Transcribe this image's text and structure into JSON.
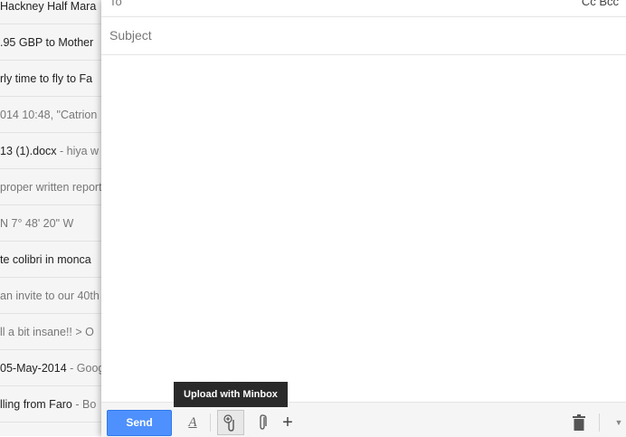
{
  "inbox": {
    "rows": [
      {
        "text": " Hackney Half Mara",
        "snippet": "",
        "read": false
      },
      {
        "text": ".95 GBP to Mother",
        "snippet": "",
        "read": false
      },
      {
        "text": "rly time to fly to Fa",
        "snippet": "",
        "read": false
      },
      {
        "text": "014 10:48, \"Catrion",
        "snippet": "",
        "read": true
      },
      {
        "text": "13 (1).docx",
        "snippet": " - hiya w",
        "read": false
      },
      {
        "text": "proper written report",
        "snippet": "",
        "read": true
      },
      {
        "text": "N 7° 48' 20\" W",
        "snippet": "",
        "read": true
      },
      {
        "text": "te colibri in monca",
        "snippet": "",
        "read": false
      },
      {
        "text": "an invite to our 40th",
        "snippet": "",
        "read": true
      },
      {
        "text": "ll a bit insane!! > O",
        "snippet": "",
        "read": true
      },
      {
        "text": "05-May-2014",
        "snippet": " - Goog",
        "read": false
      },
      {
        "text": "lling from Faro",
        "snippet": " - Bo",
        "read": false
      }
    ]
  },
  "compose": {
    "to_label": "To",
    "cc_bcc": "Cc Bcc",
    "subject_placeholder": "Subject",
    "subject_value": "",
    "body_text": ""
  },
  "toolbar": {
    "send_label": "Send",
    "format_label": "A",
    "plus_label": "+",
    "more_label": "▼"
  },
  "tooltip": {
    "text": "Upload with Minbox"
  }
}
